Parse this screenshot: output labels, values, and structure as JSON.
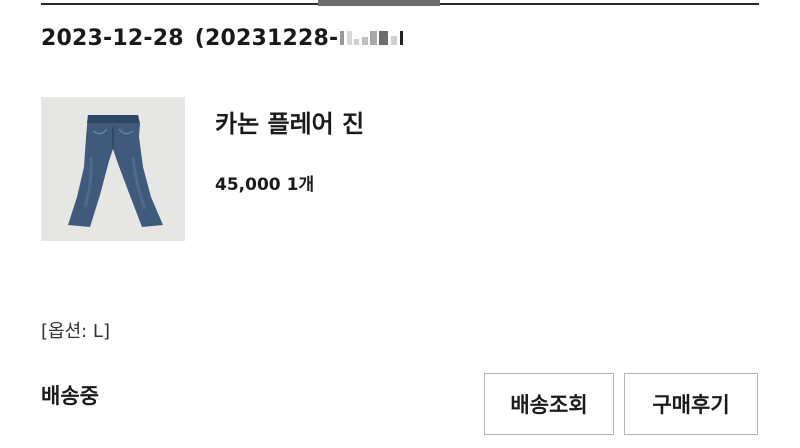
{
  "order": {
    "date": "2023-12-28",
    "number_prefix": "(20231228-",
    "number_masked": true
  },
  "product": {
    "name": "카논 플레어 진",
    "price": "45,000",
    "quantity": "1개",
    "image": "jeans-photo",
    "option": "[옵션: L]"
  },
  "status": {
    "label": "배송중"
  },
  "actions": {
    "track_label": "배송조회",
    "review_label": "구매후기"
  },
  "colors": {
    "text": "#1a1a1a",
    "border": "#b5b5b5",
    "denim": "#3f5a7a",
    "image_bg": "#e6e6e4"
  }
}
